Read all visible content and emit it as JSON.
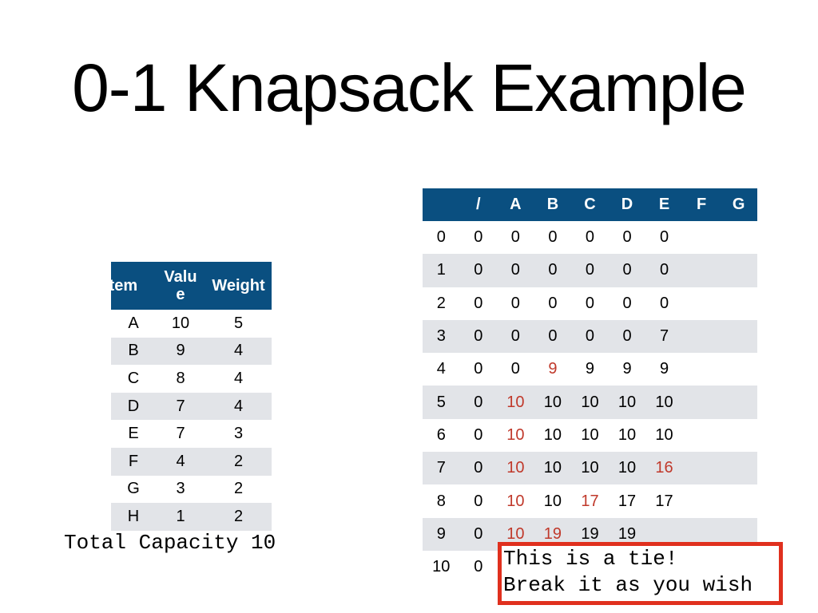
{
  "title": "0-1 Knapsack Example",
  "items_table": {
    "headers": [
      "Item",
      "Valu\ne",
      "Weight"
    ],
    "header_lines": {
      "item": "Item",
      "value_line1": "Valu",
      "value_line2": "e",
      "weight": "Weight"
    },
    "rows": [
      {
        "item": "A",
        "value": "10",
        "weight": "5"
      },
      {
        "item": "B",
        "value": "9",
        "weight": "4"
      },
      {
        "item": "C",
        "value": "8",
        "weight": "4"
      },
      {
        "item": "D",
        "value": "7",
        "weight": "4"
      },
      {
        "item": "E",
        "value": "7",
        "weight": "3"
      },
      {
        "item": "F",
        "value": "4",
        "weight": "2"
      },
      {
        "item": "G",
        "value": "3",
        "weight": "2"
      },
      {
        "item": "H",
        "value": "1",
        "weight": "2"
      }
    ]
  },
  "capacity_label": "Total Capacity 10",
  "dp_table": {
    "headers": [
      "",
      "/",
      "A",
      "B",
      "C",
      "D",
      "E",
      "F",
      "G"
    ],
    "rows": [
      {
        "label": "0",
        "cells": [
          {
            "v": "0"
          },
          {
            "v": "0"
          },
          {
            "v": "0"
          },
          {
            "v": "0"
          },
          {
            "v": "0"
          },
          {
            "v": "0"
          },
          {
            "v": ""
          },
          {
            "v": ""
          }
        ]
      },
      {
        "label": "1",
        "cells": [
          {
            "v": "0"
          },
          {
            "v": "0"
          },
          {
            "v": "0"
          },
          {
            "v": "0"
          },
          {
            "v": "0"
          },
          {
            "v": "0"
          },
          {
            "v": ""
          },
          {
            "v": ""
          }
        ]
      },
      {
        "label": "2",
        "cells": [
          {
            "v": "0"
          },
          {
            "v": "0"
          },
          {
            "v": "0"
          },
          {
            "v": "0"
          },
          {
            "v": "0"
          },
          {
            "v": "0"
          },
          {
            "v": ""
          },
          {
            "v": ""
          }
        ]
      },
      {
        "label": "3",
        "cells": [
          {
            "v": "0"
          },
          {
            "v": "0"
          },
          {
            "v": "0"
          },
          {
            "v": "0"
          },
          {
            "v": "0"
          },
          {
            "v": "7"
          },
          {
            "v": ""
          },
          {
            "v": ""
          }
        ]
      },
      {
        "label": "4",
        "cells": [
          {
            "v": "0"
          },
          {
            "v": "0"
          },
          {
            "v": "9",
            "red": true
          },
          {
            "v": "9"
          },
          {
            "v": "9"
          },
          {
            "v": "9"
          },
          {
            "v": ""
          },
          {
            "v": ""
          }
        ]
      },
      {
        "label": "5",
        "cells": [
          {
            "v": "0"
          },
          {
            "v": "10",
            "red": true
          },
          {
            "v": "10"
          },
          {
            "v": "10"
          },
          {
            "v": "10"
          },
          {
            "v": "10"
          },
          {
            "v": ""
          },
          {
            "v": ""
          }
        ]
      },
      {
        "label": "6",
        "cells": [
          {
            "v": "0"
          },
          {
            "v": "10",
            "red": true
          },
          {
            "v": "10"
          },
          {
            "v": "10"
          },
          {
            "v": "10"
          },
          {
            "v": "10"
          },
          {
            "v": ""
          },
          {
            "v": ""
          }
        ]
      },
      {
        "label": "7",
        "cells": [
          {
            "v": "0"
          },
          {
            "v": "10",
            "red": true
          },
          {
            "v": "10"
          },
          {
            "v": "10"
          },
          {
            "v": "10"
          },
          {
            "v": "16",
            "red": true
          },
          {
            "v": ""
          },
          {
            "v": ""
          }
        ]
      },
      {
        "label": "8",
        "cells": [
          {
            "v": "0"
          },
          {
            "v": "10",
            "red": true
          },
          {
            "v": "10"
          },
          {
            "v": "17",
            "red": true
          },
          {
            "v": "17"
          },
          {
            "v": "17"
          },
          {
            "v": ""
          },
          {
            "v": ""
          }
        ]
      },
      {
        "label": "9",
        "cells": [
          {
            "v": "0"
          },
          {
            "v": "10",
            "red": true
          },
          {
            "v": "19",
            "red": true
          },
          {
            "v": "19"
          },
          {
            "v": "19"
          },
          {
            "v": ""
          },
          {
            "v": ""
          },
          {
            "v": ""
          }
        ]
      },
      {
        "label": "10",
        "cells": [
          {
            "v": "0"
          },
          {
            "v": ""
          },
          {
            "v": ""
          },
          {
            "v": ""
          },
          {
            "v": ""
          },
          {
            "v": ""
          },
          {
            "v": ""
          },
          {
            "v": ""
          }
        ]
      }
    ]
  },
  "callout": {
    "line1": "This is a tie!",
    "line2": "Break it as you wish"
  },
  "colors": {
    "header_bg": "#0a4f80",
    "stripe_bg": "#e2e4e8",
    "highlight_text": "#c0392b",
    "callout_border": "#e0301e"
  }
}
